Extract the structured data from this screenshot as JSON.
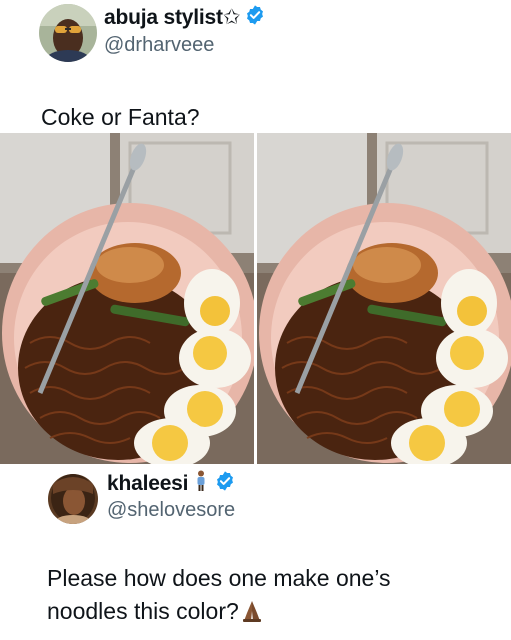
{
  "tweet1": {
    "display_name": "abuja stylist✩",
    "handle": "@drharveee",
    "text": "Coke or Fanta?",
    "verified_icon": "verified-badge-icon"
  },
  "media": {
    "left_image": "noodle-bowl-photo",
    "right_image": "noodle-bowl-photo"
  },
  "tweet2": {
    "display_name": "khaleesi",
    "name_emoji": "standing-woman-emoji",
    "handle": "@shelovesore",
    "text_line1": "Please how does one make one’s",
    "text_line2": "noodles this color?",
    "reaction_emoji": "folded-hands-emoji",
    "verified_icon": "verified-badge-icon"
  },
  "colors": {
    "verified_blue": "#1d9bf0",
    "handle_gray": "#536471",
    "text_black": "#0f1419"
  }
}
